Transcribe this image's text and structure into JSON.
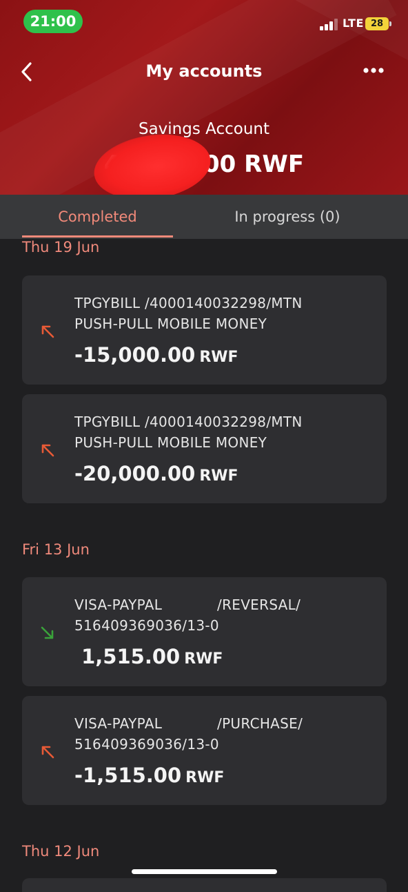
{
  "status_bar": {
    "time": "21:00",
    "network": "LTE",
    "battery": "28"
  },
  "nav": {
    "title": "My accounts"
  },
  "account": {
    "name": "Savings Account",
    "balance": "45,049.00 RWF"
  },
  "tabs": [
    {
      "label": "Completed",
      "active": true
    },
    {
      "label": "In progress (0)",
      "active": false
    }
  ],
  "groups": [
    {
      "date": "Thu 19 Jun",
      "transactions": [
        {
          "line1": "TPGYBILL /4000140032298/MTN",
          "line2": "PUSH-PULL MOBILE MONEY",
          "amount": "-15,000.00",
          "currency": "RWF",
          "direction": "out"
        },
        {
          "line1": "TPGYBILL /4000140032298/MTN",
          "line2": "PUSH-PULL MOBILE MONEY",
          "amount": "-20,000.00",
          "currency": "RWF",
          "direction": "out"
        }
      ]
    },
    {
      "date": "Fri 13 Jun",
      "transactions": [
        {
          "line1": "VISA-PAYPAL            /REVERSAL/",
          "line2": "516409369036/13-0",
          "amount": " 1,515.00",
          "currency": "RWF",
          "direction": "in"
        },
        {
          "line1": "VISA-PAYPAL            /PURCHASE/",
          "line2": "516409369036/13-0",
          "amount": "-1,515.00",
          "currency": "RWF",
          "direction": "out"
        }
      ]
    },
    {
      "date": "Thu 12 Jun",
      "transactions": []
    }
  ],
  "colors": {
    "header": "#9a1619",
    "accent": "#f28a7a",
    "out_arrow": "#e85a36",
    "in_arrow": "#3aa23a"
  }
}
